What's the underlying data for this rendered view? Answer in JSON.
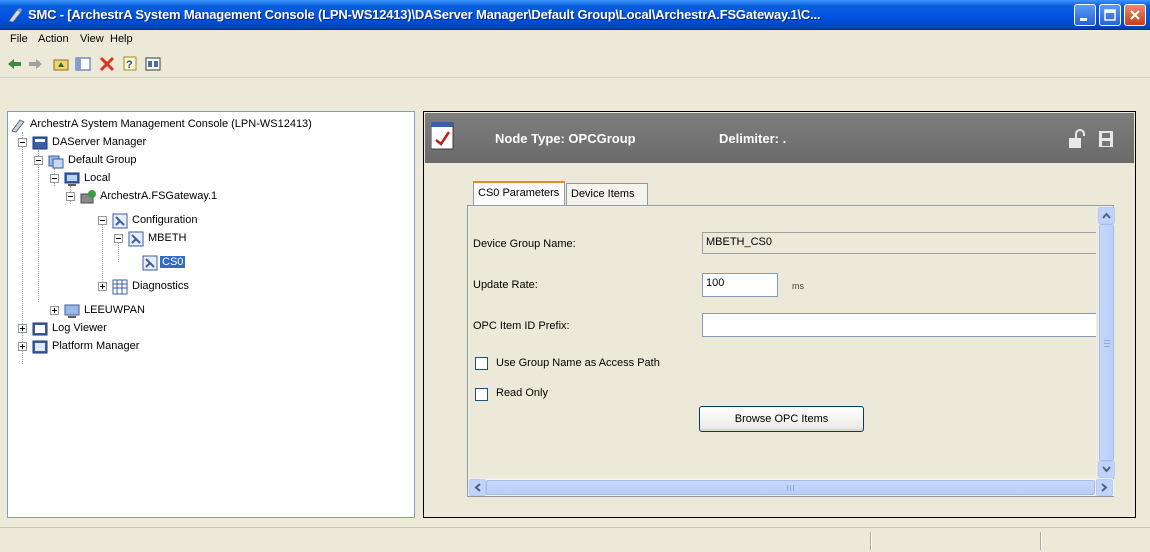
{
  "window": {
    "title": "SMC - [ArchestrA System Management Console (LPN-WS12413)\\DAServer Manager\\Default Group\\Local\\ArchestrA.FSGateway.1\\C...",
    "controls": [
      "minimize",
      "maximize",
      "close"
    ]
  },
  "menu": {
    "file": "File",
    "action": "Action",
    "view": "View",
    "help": "Help"
  },
  "toolbar": {
    "icons": [
      "back-arrow-icon",
      "forward-arrow-icon",
      "up-folder-icon",
      "show-hide-console-tree-icon",
      "delete-icon",
      "help-icon",
      "properties-icon"
    ]
  },
  "tree": {
    "root": "ArchestrA System Management Console (LPN-WS12413)",
    "daserver_manager": "DAServer Manager",
    "default_group": "Default Group",
    "local": "Local",
    "fsgateway": "ArchestrA.FSGateway.1",
    "configuration": "Configuration",
    "mbeth": "MBETH",
    "cs0": "CS0",
    "diagnostics": "Diagnostics",
    "leeuwpan": "LEEUWPAN",
    "log_viewer": "Log Viewer",
    "platform_manager": "Platform Manager"
  },
  "header": {
    "node_type": "Node Type: OPCGroup",
    "delimiter": "Delimiter: ."
  },
  "tabs": {
    "cs0_parameters": "CS0 Parameters",
    "device_items": "Device Items"
  },
  "form": {
    "device_group_name_label": "Device Group Name:",
    "device_group_name_value": "MBETH_CS0",
    "update_rate_label": "Update Rate:",
    "update_rate_value": "100",
    "update_rate_unit": "ms",
    "opc_prefix_label": "OPC Item ID Prefix:",
    "opc_prefix_value": "",
    "use_group_name_label": "Use Group Name as Access Path",
    "use_group_name_checked": false,
    "read_only_label": "Read Only",
    "read_only_checked": false,
    "browse_button": "Browse OPC Items"
  },
  "colors": {
    "title_bar": "#0054E3",
    "header_bar": "#777777",
    "selection": "#316AC5"
  }
}
